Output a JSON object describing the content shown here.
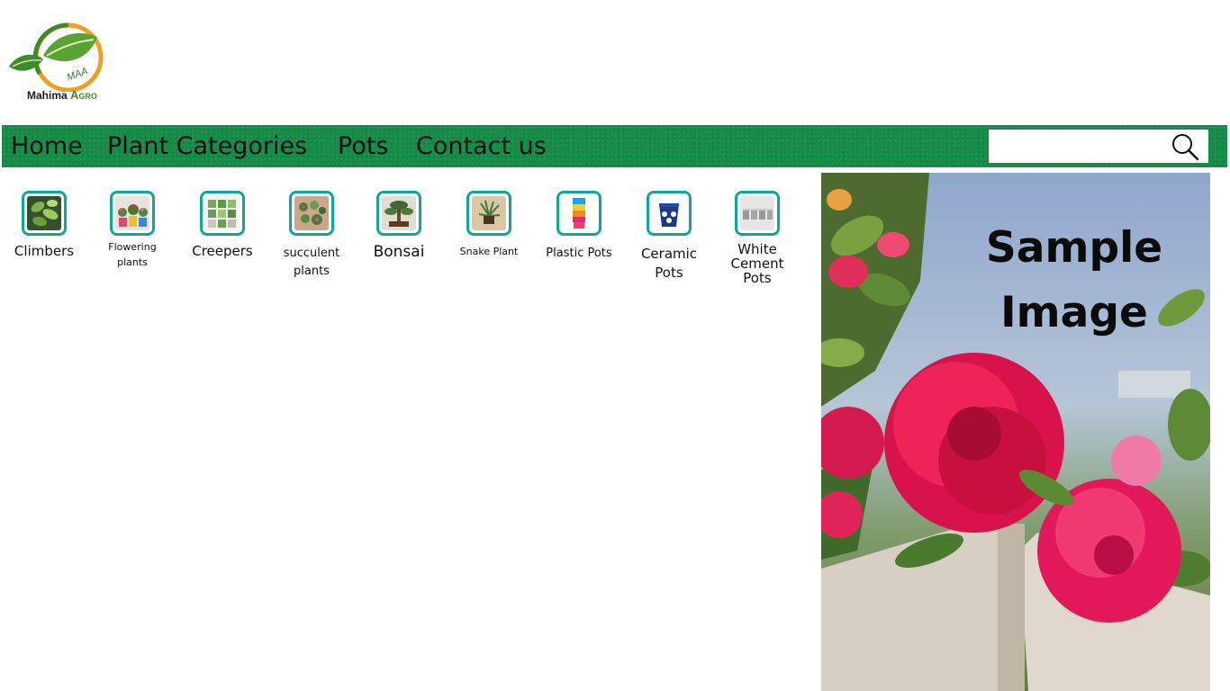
{
  "logo": {
    "badge": "MAA",
    "brand_first": "Mahima",
    "brand_second": "Agro"
  },
  "nav": {
    "items": [
      "Home",
      "Plant Categories",
      "Pots",
      "Contact us"
    ],
    "search_placeholder": "",
    "bg_color": "#168a47"
  },
  "categories": [
    {
      "label": "Climbers",
      "icon": "climber-plant-thumb"
    },
    {
      "label": "Flowering plants",
      "icon": "flowering-plant-thumb"
    },
    {
      "label": "Creepers",
      "icon": "creeper-plant-thumb"
    },
    {
      "label": "succulent plants",
      "icon": "succulent-thumb"
    },
    {
      "label": "Bonsai",
      "icon": "bonsai-thumb"
    },
    {
      "label": "Snake Plant",
      "icon": "snake-plant-thumb"
    },
    {
      "label": "Plastic Pots",
      "icon": "plastic-pots-thumb"
    },
    {
      "label": "Ceramic Pots",
      "icon": "ceramic-pot-thumb"
    },
    {
      "label": "White Cement Pots",
      "icon": "cement-pots-thumb"
    }
  ],
  "sample_image": {
    "caption": "Sample Image"
  },
  "colors": {
    "thumb_border": "#13a59a",
    "nav_green": "#168a47"
  }
}
